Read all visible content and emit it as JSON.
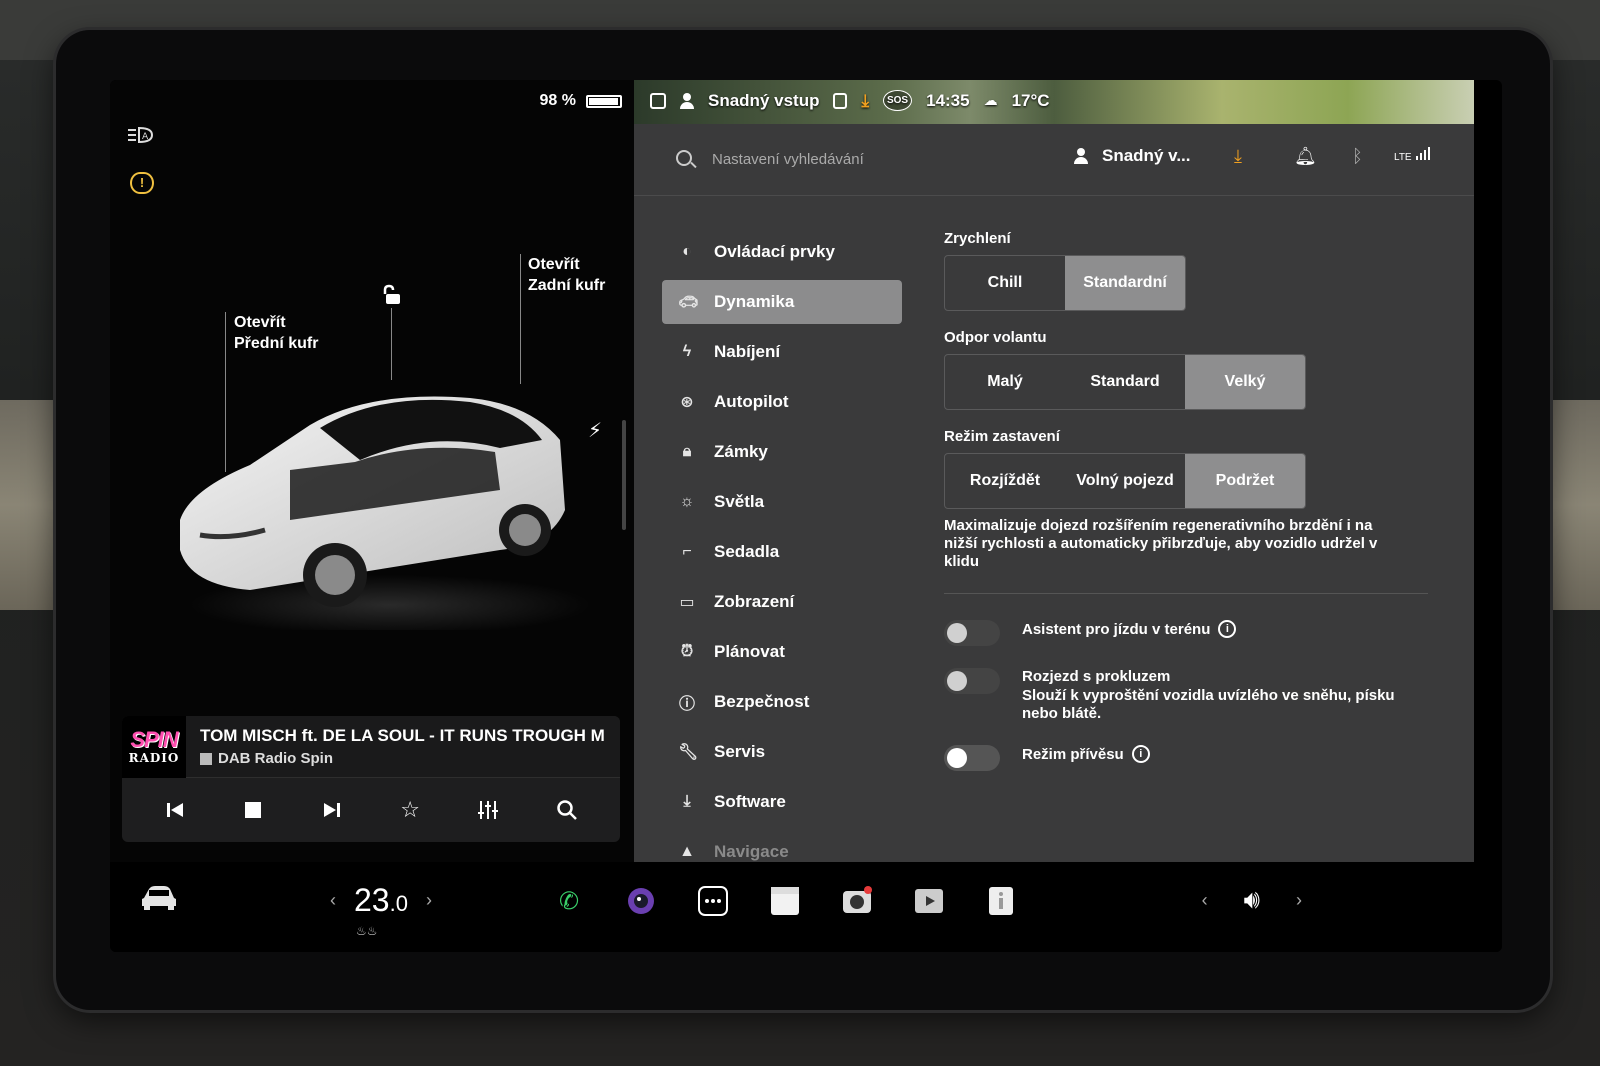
{
  "battery": {
    "percent_text": "98 %",
    "level": 0.98
  },
  "car_panel": {
    "frunk_label_1": "Otevřít",
    "frunk_label_2": "Přední kufr",
    "trunk_label_1": "Otevřít",
    "trunk_label_2": "Zadní kufr"
  },
  "media": {
    "logo_top": "SPIN",
    "logo_bottom": "RADIO",
    "song": "TOM MISCH ft. DE LA SOUL - IT RUNS TROUGH M",
    "station": "DAB Radio Spin"
  },
  "status_bar": {
    "profile": "Snadný vstup",
    "sos": "SOS",
    "time": "14:35",
    "temperature": "17°C"
  },
  "header": {
    "search_placeholder": "Nastavení vyhledávání",
    "profile": "Snadný v...",
    "lte": "LTE"
  },
  "nav": {
    "items": [
      {
        "label": "Ovládací prvky",
        "icon": "toggle-icon"
      },
      {
        "label": "Dynamika",
        "icon": "car-icon"
      },
      {
        "label": "Nabíjení",
        "icon": "bolt-icon"
      },
      {
        "label": "Autopilot",
        "icon": "steering-wheel-icon"
      },
      {
        "label": "Zámky",
        "icon": "lock-icon"
      },
      {
        "label": "Světla",
        "icon": "sun-icon"
      },
      {
        "label": "Sedadla",
        "icon": "seat-icon"
      },
      {
        "label": "Zobrazení",
        "icon": "display-icon"
      },
      {
        "label": "Plánovat",
        "icon": "alarm-clock-icon"
      },
      {
        "label": "Bezpečnost",
        "icon": "info-circle-icon"
      },
      {
        "label": "Servis",
        "icon": "wrench-icon"
      },
      {
        "label": "Software",
        "icon": "download-icon"
      },
      {
        "label": "Navigace",
        "icon": "navigation-icon"
      }
    ],
    "active_index": 1
  },
  "dynamics": {
    "acceleration": {
      "title": "Zrychlení",
      "options": [
        "Chill",
        "Standardní"
      ],
      "selected": "Standardní"
    },
    "steering": {
      "title": "Odpor volantu",
      "options": [
        "Malý",
        "Standard",
        "Velký"
      ],
      "selected": "Velký"
    },
    "stopping": {
      "title": "Režim zastavení",
      "options": [
        "Rozjíždět",
        "Volný pojezd",
        "Podržet"
      ],
      "selected": "Podržet"
    },
    "stopping_desc": "Maximalizuje dojezd rozšířením regenerativního brzdění i na nižší rychlosti a automaticky přibrzďuje, aby vozidlo udržel v klidu",
    "offroad": {
      "label": "Asistent pro jízdu v terénu",
      "on": false
    },
    "slip_start": {
      "label": "Rozjezd s prokluzem",
      "desc": "Slouží k vyproštění vozidla uvízlého ve sněhu, písku nebo blátě.",
      "on": false
    },
    "trailer": {
      "label": "Režim přívěsu",
      "on": false
    }
  },
  "bottom_bar": {
    "temp_int": "23",
    "temp_dec": ".0",
    "temp_left": "‹",
    "temp_right": "›",
    "vol_left": "‹",
    "vol_right": "›"
  },
  "colors": {
    "active_segment": "#8e8e8f",
    "panel": "#3a3a3b",
    "warning": "#f0c040",
    "download": "#f0a020"
  }
}
